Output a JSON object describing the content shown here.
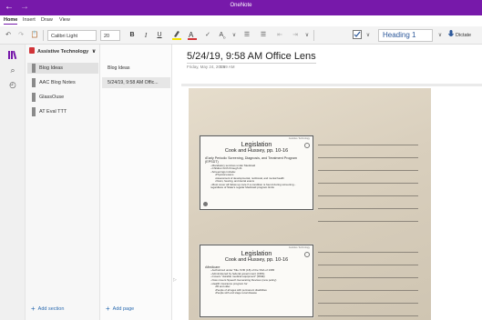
{
  "window": {
    "title": "OneNote",
    "back_glyph": "←",
    "forward_glyph": "→"
  },
  "ribbon": {
    "tabs": [
      {
        "label": "Home",
        "active": true
      },
      {
        "label": "Insert",
        "active": false
      },
      {
        "label": "Draw",
        "active": false
      },
      {
        "label": "View",
        "active": false
      }
    ],
    "font_name": "Calibri Light",
    "font_size": "20",
    "bold": "B",
    "italic": "I",
    "underline": "U",
    "style": "Heading 1",
    "dictate": "Dictate"
  },
  "notebook": {
    "name": "Assistive Technology",
    "caret": "∨",
    "sections": [
      {
        "label": "Blog Ideas",
        "color": "#8a8a8a",
        "selected": true
      },
      {
        "label": "AAC Blog Notes",
        "color": "#8a8a8a",
        "selected": false
      },
      {
        "label": "GlassOuse",
        "color": "#8a8a8a",
        "selected": false
      },
      {
        "label": "AT Eval TTT",
        "color": "#8a8a8a",
        "selected": false
      }
    ],
    "add_section": "Add section"
  },
  "pages": {
    "items": [
      {
        "label": "Blog Ideas",
        "selected": false
      },
      {
        "label": "5/24/19, 9:58 AM Offic...",
        "selected": true
      }
    ],
    "add_page": "Add page"
  },
  "page": {
    "title": "5/24/19, 9:58 AM Office Lens",
    "date": "Friday, May 24, 2019",
    "time": "9:59 AM",
    "slides": [
      {
        "small": "Assistive Technology",
        "title": "Legislation",
        "subtitle": "Cook and Hussey, pp. 10-16",
        "bullets": [
          {
            "text": "Early Periodic Screening, Diagnosis, and Treatment Program (EPSDT)",
            "level": 0
          },
          {
            "text": "Mandatory services under Medicaid",
            "level": 1
          },
          {
            "text": "Children birth through 21",
            "level": 1
          },
          {
            "text": "Screenings include:",
            "level": 1
          },
          {
            "text": "Physical exams",
            "level": 2
          },
          {
            "text": "Assessment of developmental, nutritional, and mental health",
            "level": 2
          },
          {
            "text": "Vision, hearing, and dental exams",
            "level": 2
          },
          {
            "text": "Must cover all follow up care if a condition is found during screening - regardless of State's regular Medicaid program limits",
            "level": 1
          }
        ]
      },
      {
        "small": "Assistive Technology",
        "title": "Legislation",
        "subtitle": "Cook and Hussey, pp. 10-16",
        "bullets": [
          {
            "text": "Medicare",
            "level": 0
          },
          {
            "text": "Authorized under Title XVIII (18) of the SSA of 1965",
            "level": 1
          },
          {
            "text": "Administered by federal government (CMS)",
            "level": 1
          },
          {
            "text": "Covers \"durable medical equipment\" (DME)",
            "level": 1
          },
          {
            "text": "Now covers Speech Generating Devices (new policy)",
            "level": 1
          },
          {
            "text": "Health insurance program for:",
            "level": 1
          },
          {
            "text": "65 and older",
            "level": 2
          },
          {
            "text": "People of all ages with permanent disabilities",
            "level": 2
          },
          {
            "text": "People with end stage renal disease",
            "level": 2
          }
        ]
      }
    ]
  }
}
